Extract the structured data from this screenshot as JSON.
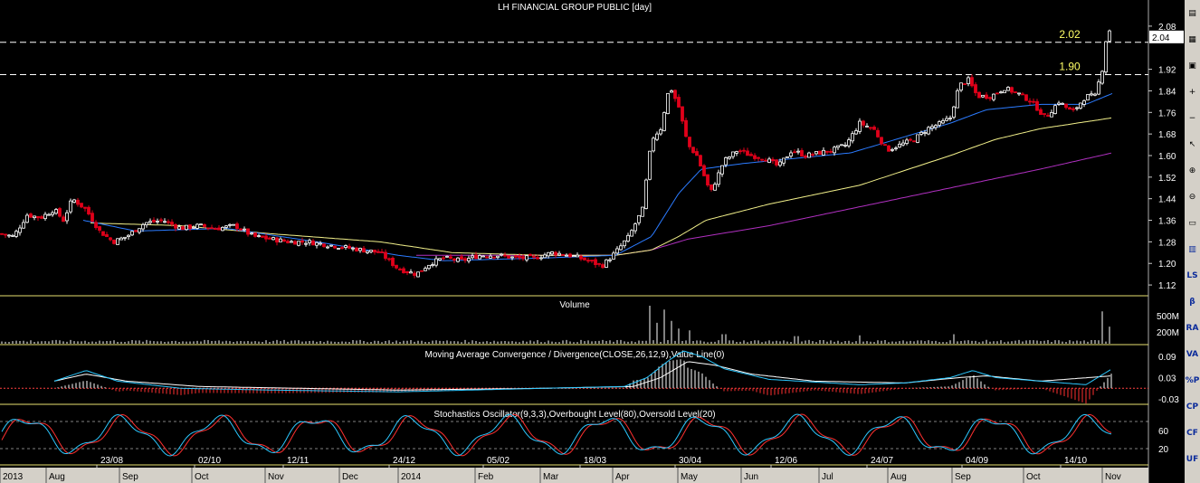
{
  "window": {
    "title": "LH FINANCIAL GROUP PUBLIC [day]"
  },
  "colors": {
    "background": "#000000",
    "up_candle": "#ffffff",
    "down_candle": "#e0001a",
    "ma_fast": "#2b7bff",
    "ma_mid": "#f2f08a",
    "ma_slow": "#b030c0",
    "price_line": "#ffffff",
    "level_label": "#ffff66",
    "stoch_k": "#2cc8ff",
    "stoch_d": "#ff3030"
  },
  "toolbar": {
    "items": [
      {
        "name": "document-icon",
        "glyph": "▤"
      },
      {
        "name": "chart-properties-icon",
        "glyph": "▦"
      },
      {
        "name": "zoom-icon",
        "glyph": "▣"
      },
      {
        "name": "zoom-in-icon",
        "glyph": "+"
      },
      {
        "name": "zoom-out-icon",
        "glyph": "−"
      },
      {
        "name": "cursor-icon",
        "glyph": "↖"
      },
      {
        "name": "magnifier-in-icon",
        "glyph": "⊕"
      },
      {
        "name": "magnifier-out-icon",
        "glyph": "⊖"
      },
      {
        "name": "window-icon",
        "glyph": "▭"
      },
      {
        "name": "indicator-icon",
        "glyph": "▥"
      },
      {
        "name": "ls-button",
        "glyph": "LS"
      },
      {
        "name": "beta-button",
        "glyph": "β"
      },
      {
        "name": "ra-button",
        "glyph": "RA"
      },
      {
        "name": "va-button",
        "glyph": "VA"
      },
      {
        "name": "percent-p-button",
        "glyph": "%P"
      },
      {
        "name": "cp-button",
        "glyph": "CP"
      },
      {
        "name": "cf-button",
        "glyph": "CF"
      },
      {
        "name": "uf-button",
        "glyph": "UF"
      }
    ]
  },
  "chart_data": [
    {
      "type": "candlestick",
      "title": "LH FINANCIAL GROUP PUBLIC [day]",
      "ylim": [
        1.08,
        2.13
      ],
      "y_ticks": [
        "1.12",
        "1.20",
        "1.28",
        "1.36",
        "1.44",
        "1.52",
        "1.60",
        "1.68",
        "1.76",
        "1.84",
        "1.92",
        "2.08"
      ],
      "last_price": "2.04",
      "horizontal_levels": [
        {
          "value": 2.02,
          "label": "2.02"
        },
        {
          "value": 1.9,
          "label": "1.90"
        }
      ],
      "x_labels_top": [
        "23/08",
        "02/10",
        "12/11",
        "24/12",
        "05/02",
        "18/03",
        "30/04",
        "12/06",
        "24/07",
        "04/09",
        "14/10"
      ],
      "x_labels_bottom": [
        "2013",
        "Aug",
        "Sep",
        "Oct",
        "Nov",
        "Dec",
        "2014",
        "Feb",
        "Mar",
        "Apr",
        "May",
        "Jun",
        "Jul",
        "Aug",
        "Sep",
        "Oct",
        "Nov"
      ],
      "close_points": [
        [
          0,
          1.31
        ],
        [
          15,
          1.3
        ],
        [
          30,
          1.38
        ],
        [
          45,
          1.37
        ],
        [
          60,
          1.4
        ],
        [
          70,
          1.36
        ],
        [
          80,
          1.44
        ],
        [
          95,
          1.4
        ],
        [
          110,
          1.32
        ],
        [
          125,
          1.28
        ],
        [
          140,
          1.3
        ],
        [
          160,
          1.35
        ],
        [
          180,
          1.36
        ],
        [
          200,
          1.33
        ],
        [
          220,
          1.34
        ],
        [
          240,
          1.33
        ],
        [
          260,
          1.34
        ],
        [
          280,
          1.3
        ],
        [
          300,
          1.29
        ],
        [
          320,
          1.28
        ],
        [
          340,
          1.28
        ],
        [
          360,
          1.27
        ],
        [
          380,
          1.26
        ],
        [
          400,
          1.25
        ],
        [
          420,
          1.24
        ],
        [
          440,
          1.18
        ],
        [
          460,
          1.16
        ],
        [
          475,
          1.2
        ],
        [
          490,
          1.22
        ],
        [
          510,
          1.21
        ],
        [
          530,
          1.23
        ],
        [
          550,
          1.23
        ],
        [
          570,
          1.22
        ],
        [
          590,
          1.22
        ],
        [
          610,
          1.24
        ],
        [
          630,
          1.23
        ],
        [
          650,
          1.21
        ],
        [
          665,
          1.19
        ],
        [
          680,
          1.24
        ],
        [
          695,
          1.3
        ],
        [
          710,
          1.4
        ],
        [
          720,
          1.66
        ],
        [
          730,
          1.7
        ],
        [
          740,
          1.86
        ],
        [
          750,
          1.78
        ],
        [
          760,
          1.64
        ],
        [
          770,
          1.6
        ],
        [
          785,
          1.46
        ],
        [
          800,
          1.58
        ],
        [
          815,
          1.62
        ],
        [
          830,
          1.6
        ],
        [
          845,
          1.59
        ],
        [
          860,
          1.56
        ],
        [
          875,
          1.62
        ],
        [
          890,
          1.6
        ],
        [
          905,
          1.61
        ],
        [
          920,
          1.62
        ],
        [
          935,
          1.64
        ],
        [
          950,
          1.72
        ],
        [
          965,
          1.7
        ],
        [
          980,
          1.62
        ],
        [
          995,
          1.64
        ],
        [
          1010,
          1.66
        ],
        [
          1025,
          1.7
        ],
        [
          1040,
          1.72
        ],
        [
          1050,
          1.74
        ],
        [
          1060,
          1.86
        ],
        [
          1070,
          1.88
        ],
        [
          1080,
          1.82
        ],
        [
          1095,
          1.82
        ],
        [
          1110,
          1.85
        ],
        [
          1125,
          1.83
        ],
        [
          1140,
          1.8
        ],
        [
          1155,
          1.74
        ],
        [
          1170,
          1.8
        ],
        [
          1185,
          1.76
        ],
        [
          1200,
          1.82
        ],
        [
          1210,
          1.82
        ],
        [
          1218,
          1.92
        ],
        [
          1224,
          2.08
        ],
        [
          1229,
          2.04
        ]
      ],
      "ma_fast": [
        [
          92,
          1.36
        ],
        [
          150,
          1.32
        ],
        [
          250,
          1.33
        ],
        [
          350,
          1.28
        ],
        [
          440,
          1.23
        ],
        [
          490,
          1.21
        ],
        [
          600,
          1.22
        ],
        [
          680,
          1.23
        ],
        [
          720,
          1.3
        ],
        [
          750,
          1.46
        ],
        [
          775,
          1.55
        ],
        [
          820,
          1.57
        ],
        [
          880,
          1.59
        ],
        [
          940,
          1.61
        ],
        [
          1000,
          1.67
        ],
        [
          1050,
          1.72
        ],
        [
          1090,
          1.77
        ],
        [
          1150,
          1.79
        ],
        [
          1200,
          1.79
        ],
        [
          1229,
          1.83
        ]
      ],
      "ma_mid": [
        [
          100,
          1.35
        ],
        [
          200,
          1.34
        ],
        [
          300,
          1.31
        ],
        [
          420,
          1.28
        ],
        [
          500,
          1.24
        ],
        [
          600,
          1.23
        ],
        [
          680,
          1.23
        ],
        [
          720,
          1.25
        ],
        [
          750,
          1.3
        ],
        [
          780,
          1.36
        ],
        [
          850,
          1.42
        ],
        [
          950,
          1.49
        ],
        [
          1050,
          1.6
        ],
        [
          1100,
          1.66
        ],
        [
          1150,
          1.7
        ],
        [
          1229,
          1.74
        ]
      ],
      "ma_slow": [
        [
          460,
          1.23
        ],
        [
          600,
          1.23
        ],
        [
          680,
          1.23
        ],
        [
          720,
          1.25
        ],
        [
          760,
          1.29
        ],
        [
          850,
          1.34
        ],
        [
          950,
          1.41
        ],
        [
          1050,
          1.48
        ],
        [
          1150,
          1.55
        ],
        [
          1229,
          1.61
        ]
      ]
    },
    {
      "type": "bar",
      "title": "Volume",
      "y_ticks": [
        "500M",
        "200M"
      ],
      "spikes": [
        [
          718,
          1.0
        ],
        [
          726,
          0.55
        ],
        [
          735,
          0.9
        ],
        [
          742,
          0.6
        ],
        [
          750,
          0.4
        ],
        [
          762,
          0.35
        ],
        [
          800,
          0.25
        ],
        [
          880,
          0.2
        ],
        [
          950,
          0.22
        ],
        [
          1055,
          0.25
        ],
        [
          1217,
          0.85
        ],
        [
          1226,
          0.45
        ]
      ]
    },
    {
      "type": "line",
      "title": "Moving Average Convergence / Divergence(CLOSE,26,12,9),Value Line(0)",
      "y_ticks": [
        "0.09",
        "0.03",
        "-0.03"
      ],
      "macd": [
        [
          60,
          0.02
        ],
        [
          95,
          0.05
        ],
        [
          130,
          0.02
        ],
        [
          200,
          0.0
        ],
        [
          300,
          -0.005
        ],
        [
          440,
          -0.01
        ],
        [
          600,
          0.0
        ],
        [
          690,
          0.005
        ],
        [
          715,
          0.03
        ],
        [
          740,
          0.08
        ],
        [
          755,
          0.105
        ],
        [
          775,
          0.09
        ],
        [
          800,
          0.055
        ],
        [
          850,
          0.025
        ],
        [
          950,
          0.01
        ],
        [
          1000,
          0.015
        ],
        [
          1050,
          0.03
        ],
        [
          1075,
          0.05
        ],
        [
          1100,
          0.03
        ],
        [
          1150,
          0.02
        ],
        [
          1200,
          0.01
        ],
        [
          1229,
          0.055
        ]
      ],
      "signal": [
        [
          60,
          0.02
        ],
        [
          95,
          0.04
        ],
        [
          140,
          0.02
        ],
        [
          220,
          0.005
        ],
        [
          440,
          -0.005
        ],
        [
          600,
          0.0
        ],
        [
          700,
          0.005
        ],
        [
          730,
          0.03
        ],
        [
          760,
          0.075
        ],
        [
          790,
          0.065
        ],
        [
          830,
          0.04
        ],
        [
          900,
          0.02
        ],
        [
          1000,
          0.015
        ],
        [
          1060,
          0.03
        ],
        [
          1090,
          0.035
        ],
        [
          1150,
          0.02
        ],
        [
          1229,
          0.035
        ]
      ]
    },
    {
      "type": "line",
      "title": "Stochastics Oscillator(9,3,3),Overbought Level(80),Oversold Level(20)",
      "y_ticks": [
        "60",
        "20"
      ],
      "levels": [
        80,
        20
      ]
    }
  ]
}
